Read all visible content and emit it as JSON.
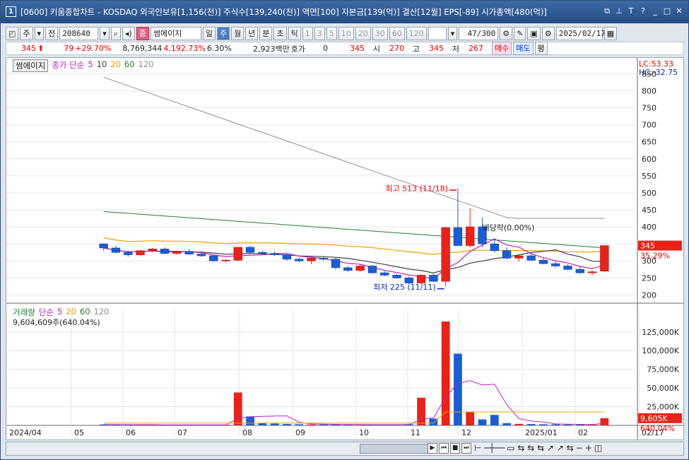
{
  "window": {
    "title": "[0600] 키움종합차트 - KOSDAQ 외국인보유[1,156(천)] 주식수[139,240(천)] 액면[100] 자본금[139(억)] 결산[12월] EPS[-89] 시가총액[480(억)]",
    "number": "1"
  },
  "toolbar": {
    "period_week": "주",
    "prev": "전",
    "code": "208640",
    "name": "썸에이지",
    "badge": "종",
    "periods": [
      "일",
      "주",
      "월",
      "년",
      "분",
      "초",
      "틱"
    ],
    "active_period": "주",
    "minutes": [
      "1",
      "3",
      "5",
      "10",
      "20",
      "30",
      "60",
      "120"
    ],
    "count": "47/300",
    "date": "2025/02/17"
  },
  "quote": {
    "price": "345",
    "change": "79",
    "change_rate": "+29.70%",
    "volume": "8,769,344",
    "vol_rate": "4,192.73%",
    "turnover": "6.30%",
    "amount": "2,923백만",
    "hoga_label": "호가",
    "hoga": "0",
    "hoga_price": "345",
    "open_label": "시",
    "open": "270",
    "high_label": "고",
    "high": "345",
    "low_label": "저",
    "low": "267",
    "buy": "매수",
    "sell": "매도",
    "avg": "평"
  },
  "legend": {
    "name": "썸에이지",
    "ma_label": "종가 단순",
    "ma": [
      "5",
      "10",
      "20",
      "60",
      "120"
    ],
    "ma_colors": [
      "#c020c0",
      "#404040",
      "#f0a000",
      "#208030",
      "#909090"
    ]
  },
  "vol_legend": {
    "label": "거래량",
    "ma_label": "단순",
    "ma": [
      "5",
      "20",
      "60",
      "120"
    ],
    "info": "9,604,609주(640.04%)"
  },
  "indicators": {
    "lc": "LC:53.33",
    "hc": "HC:-32.75",
    "last_price": "345",
    "last_rate": "35.29%",
    "last_vol": "9,605K",
    "last_vol_rate": "640.04%"
  },
  "annotations": {
    "high": "최고 513 (11/18)",
    "low": "최저 225 (11/11)",
    "dividend": "배당락(0.00%)"
  },
  "price_axis": [
    "850",
    "800",
    "750",
    "700",
    "650",
    "600",
    "550",
    "500",
    "450",
    "400",
    "350",
    "300",
    "250",
    "200"
  ],
  "vol_axis": [
    "125,000K",
    "100,000K",
    "75,000K",
    "50,000K",
    "25,000K"
  ],
  "x_axis": [
    "2024/04",
    "05",
    "06",
    "07",
    "08",
    "09",
    "10",
    "11",
    "12",
    "2025/01",
    "02",
    "02/17"
  ],
  "chart_data": {
    "type": "candlestick",
    "candles": [
      [
        350,
        352,
        330,
        338
      ],
      [
        338,
        345,
        322,
        325
      ],
      [
        325,
        330,
        312,
        318
      ],
      [
        318,
        332,
        315,
        330
      ],
      [
        330,
        338,
        325,
        335
      ],
      [
        335,
        340,
        320,
        322
      ],
      [
        322,
        330,
        318,
        328
      ],
      [
        328,
        335,
        318,
        320
      ],
      [
        320,
        328,
        312,
        315
      ],
      [
        315,
        318,
        298,
        300
      ],
      [
        300,
        305,
        295,
        302
      ],
      [
        302,
        320,
        298,
        340
      ],
      [
        340,
        345,
        320,
        325
      ],
      [
        325,
        330,
        318,
        322
      ],
      [
        322,
        328,
        315,
        318
      ],
      [
        318,
        322,
        300,
        305
      ],
      [
        305,
        310,
        295,
        300
      ],
      [
        300,
        312,
        290,
        308
      ],
      [
        308,
        312,
        300,
        305
      ],
      [
        305,
        310,
        275,
        280
      ],
      [
        280,
        285,
        268,
        272
      ],
      [
        272,
        290,
        268,
        285
      ],
      [
        285,
        288,
        262,
        265
      ],
      [
        265,
        270,
        255,
        258
      ],
      [
        258,
        262,
        248,
        250
      ],
      [
        250,
        255,
        232,
        235
      ],
      [
        235,
        262,
        230,
        258
      ],
      [
        258,
        262,
        238,
        240
      ],
      [
        240,
        400,
        225,
        398
      ],
      [
        398,
        513,
        345,
        345
      ],
      [
        345,
        455,
        340,
        400
      ],
      [
        400,
        428,
        340,
        350
      ],
      [
        350,
        365,
        325,
        330
      ],
      [
        330,
        340,
        305,
        308
      ],
      [
        308,
        318,
        298,
        315
      ],
      [
        315,
        320,
        300,
        302
      ],
      [
        302,
        308,
        290,
        292
      ],
      [
        292,
        298,
        280,
        285
      ],
      [
        285,
        290,
        272,
        275
      ],
      [
        275,
        282,
        262,
        265
      ],
      [
        265,
        272,
        258,
        268
      ],
      [
        270,
        345,
        267,
        345
      ]
    ],
    "volumes": [
      1200,
      900,
      800,
      700,
      900,
      600,
      500,
      700,
      600,
      800,
      900,
      44000,
      12000,
      3000,
      2500,
      1800,
      1500,
      1200,
      1100,
      1000,
      900,
      800,
      900,
      1100,
      1200,
      1500,
      37000,
      9000,
      139000,
      96000,
      18000,
      8000,
      14000,
      3000,
      2000,
      1800,
      1500,
      1400,
      1200,
      1000,
      900,
      9600
    ]
  }
}
